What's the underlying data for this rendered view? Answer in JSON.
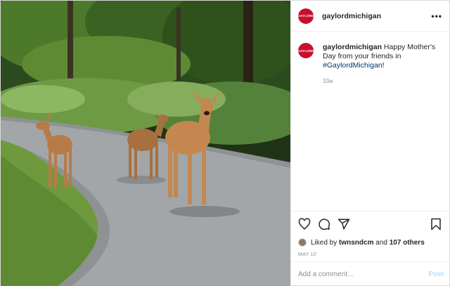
{
  "post": {
    "account": {
      "username": "gaylordmichigan",
      "avatar_text": "GAYLORD",
      "avatar_color": "#c8102e"
    },
    "more_icon": "more-horizontal-icon",
    "caption": {
      "username": "gaylordmichigan",
      "text": " Happy Mother's Day from your friends in ",
      "hashtag": "#GaylordMichigan",
      "suffix": "!",
      "age": "33w"
    },
    "actions": {
      "icons": [
        "heart-icon",
        "comment-icon",
        "share-icon",
        "bookmark-icon"
      ]
    },
    "likes": {
      "prefix": "Liked by ",
      "user": "twnsndcm",
      "conjunction": " and ",
      "others": "107 others"
    },
    "date": "MAY 10",
    "comment_box": {
      "placeholder": "Add a comment...",
      "post_label": "Post"
    },
    "colors": {
      "link": "#00376b",
      "muted": "#8e8e8e",
      "post_disabled": "#b2dffc"
    }
  }
}
